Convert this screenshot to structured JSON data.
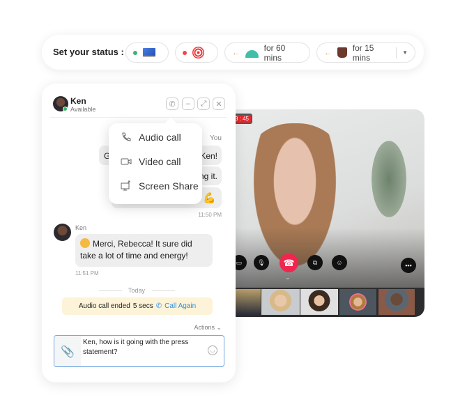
{
  "status_bar": {
    "label": "Set your status :",
    "options": [
      {
        "icon": "laptop-icon",
        "dot_color": "#3cb371"
      },
      {
        "icon": "target-icon",
        "dot_color": "#f04848"
      },
      {
        "icon": "serving-bell-icon",
        "text": "for 60 mins"
      },
      {
        "icon": "coffee-mug-icon",
        "text": "for 15 mins"
      }
    ],
    "dropdown_icon": "caret-down-icon"
  },
  "chat": {
    "contact_name": "Ken",
    "contact_status": "Available",
    "header_buttons": [
      "phone-icon",
      "minimize-icon",
      "expand-icon",
      "close-icon"
    ],
    "call_menu": [
      {
        "icon": "phone-icon",
        "label": "Audio call"
      },
      {
        "icon": "video-camera-icon",
        "label": "Video call"
      },
      {
        "icon": "screen-share-icon",
        "label": "Screen Share"
      }
    ],
    "you_label": "You",
    "sent_fragments": [
      "G",
      "Ken!",
      "ng it."
    ],
    "sent_time": "11:50 PM",
    "received_sender": "Ken",
    "received_text": "Merci, Rebecca! It sure did take a lot of time and energy!",
    "received_time": "11:51 PM",
    "day_divider": "Today",
    "call_notice": {
      "text": "Audio call ended",
      "duration": "5 secs",
      "action": "Call Again"
    },
    "actions_label": "Actions",
    "input_value": "Ken, how is it going with the press statement?"
  },
  "video": {
    "timer": "3 : 45",
    "controls": [
      "camera-icon",
      "microphone-icon",
      "end-call-icon",
      "screen-share-icon",
      "emoji-icon",
      "more-icon"
    ],
    "colors": {
      "end_call": "#f0264f",
      "timer_bg": "#e8262c"
    }
  }
}
